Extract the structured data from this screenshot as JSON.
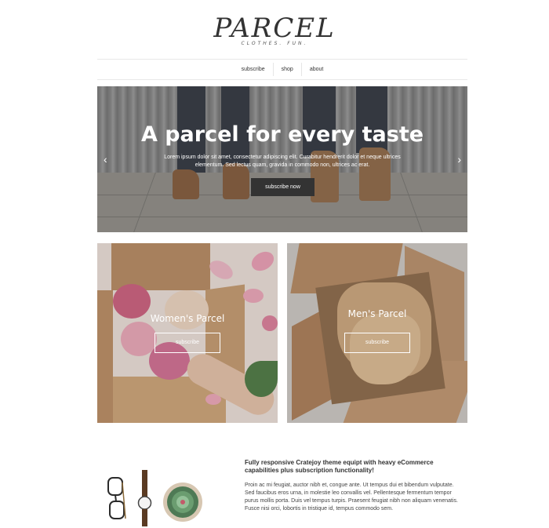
{
  "logo": {
    "name": "PARCEL",
    "tagline": "CLOTHES. FUN."
  },
  "nav": {
    "items": [
      "subscribe",
      "shop",
      "about"
    ]
  },
  "hero": {
    "title": "A parcel for every taste",
    "text": "Lorem ipsum dolor sit amet, consectetur adipiscing elit. Curabitur hendrerit dolor et neque ultrices elementum. Sed lectus quam, gravida in commodo non, ultrices ac erat.",
    "button": "subscribe now",
    "arrow_left": "‹",
    "arrow_right": "›"
  },
  "tiles": [
    {
      "title": "Women's Parcel",
      "button": "subscribe"
    },
    {
      "title": "Men's Parcel",
      "button": "subscribe"
    }
  ],
  "about": {
    "heading": "Fully responsive Cratejoy theme equipt with heavy eCommerce capabilities plus subscription functionality!",
    "text": "Proin ac mi feugiat, auctor nibh et, congue ante. Ut tempus dui et bibendum vulputate. Sed faucibus eros urna, in molestie leo convallis vel. Pellentesque fermentum tempor purus mollis porta. Duis vel tempus turpis. Praesent feugiat nibh non aliquam venenatis. Fusce nisi orci, lobortis in tristique id, tempus commodo sem."
  },
  "colors": {
    "dark_button": "#333333",
    "text": "#333333",
    "border": "#e8e8e8"
  }
}
